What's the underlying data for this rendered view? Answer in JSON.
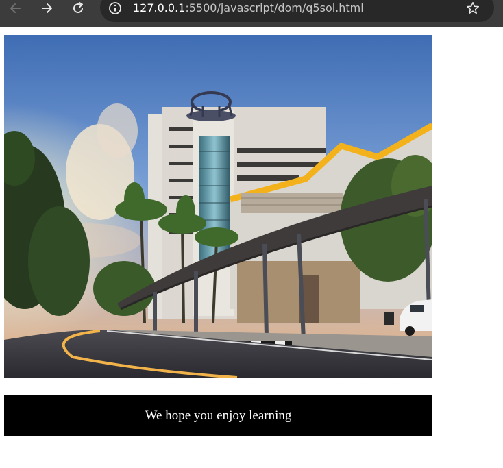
{
  "browser": {
    "url_host": "127.0.0.1",
    "url_path": ":5500/javascript/dom/q5sol.html",
    "icons": {
      "back": "arrow-left-icon",
      "forward": "arrow-right-icon",
      "reload": "reload-icon",
      "info": "info-icon",
      "bookmark": "star-icon"
    }
  },
  "page": {
    "banner_text": "We hope you enjoy learning",
    "banner_bg": "#000000",
    "banner_fg": "#ffffff"
  }
}
